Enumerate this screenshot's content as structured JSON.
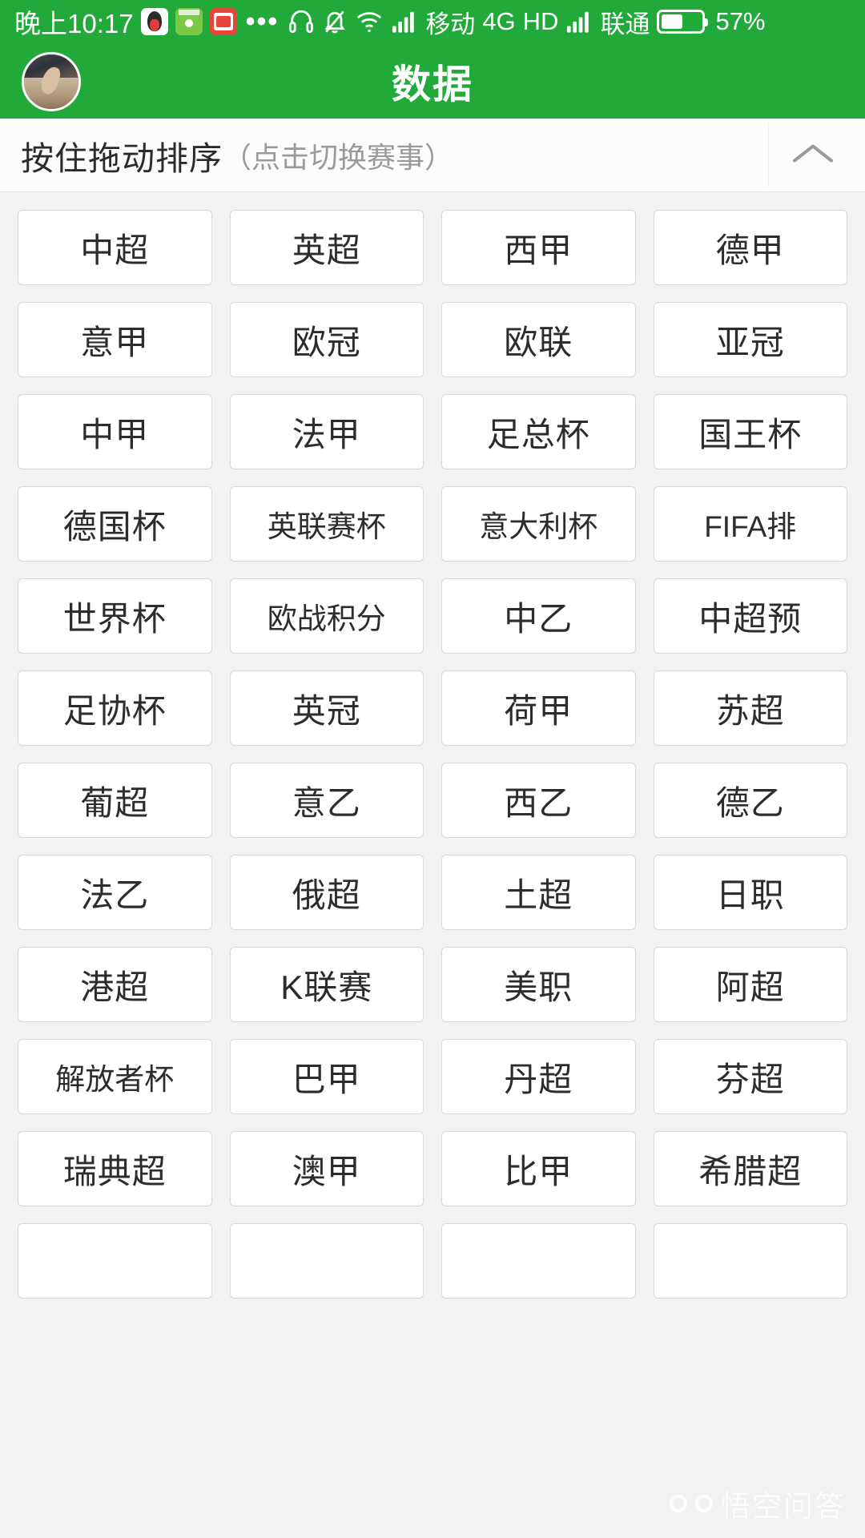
{
  "statusbar": {
    "time": "晚上10:17",
    "app_icons": [
      "qq-icon",
      "green-app-icon",
      "toutiao-icon"
    ],
    "ellipsis": "•••",
    "icons": [
      "headset-icon",
      "bell-off-icon",
      "wifi-icon",
      "signal-icon",
      "signal-icon-2"
    ],
    "carrier1": "移动",
    "network": "4G",
    "hd": "HD",
    "carrier2": "联通",
    "battery_percent": "57%",
    "background_color": "#21a93a"
  },
  "header": {
    "title": "数据",
    "avatar": "user-avatar-photo",
    "background_color": "#21a93a"
  },
  "sort_header": {
    "main_label": "按住拖动排序",
    "sub_label": "（点击切换赛事）",
    "collapse_icon": "chevron-up-icon"
  },
  "grid": {
    "columns": 4,
    "tiles": [
      "中超",
      "英超",
      "西甲",
      "德甲",
      "意甲",
      "欧冠",
      "欧联",
      "亚冠",
      "中甲",
      "法甲",
      "足总杯",
      "国王杯",
      "德国杯",
      "英联赛杯",
      "意大利杯",
      "FIFA排",
      "世界杯",
      "欧战积分",
      "中乙",
      "中超预",
      "足协杯",
      "英冠",
      "荷甲",
      "苏超",
      "葡超",
      "意乙",
      "西乙",
      "德乙",
      "法乙",
      "俄超",
      "土超",
      "日职",
      "港超",
      "K联赛",
      "美职",
      "阿超",
      "解放者杯",
      "巴甲",
      "丹超",
      "芬超",
      "瑞典超",
      "澳甲",
      "比甲",
      "希腊超",
      "",
      "",
      "",
      ""
    ]
  },
  "watermark": {
    "text": "悟空问答",
    "logo": "wukong-logo-icon"
  }
}
